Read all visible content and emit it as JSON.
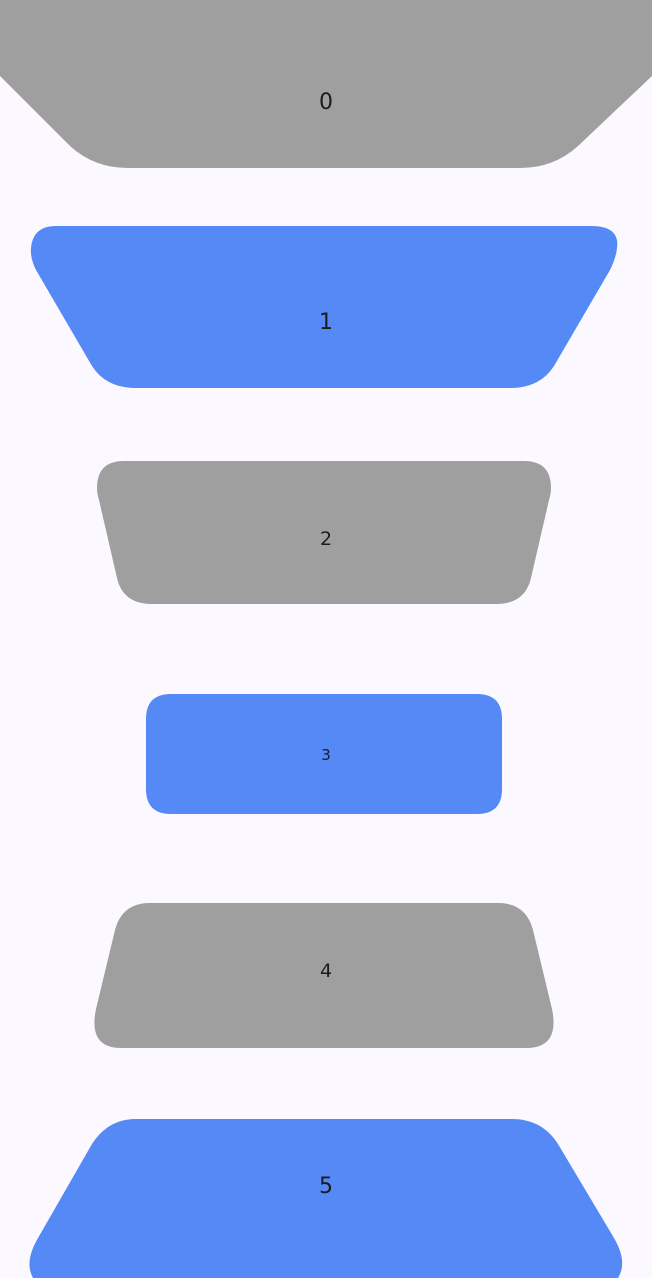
{
  "colors": {
    "background": "#fcf8ff",
    "gray": "#9f9f9f",
    "blue": "#5589f6",
    "text": "#1d1b20"
  },
  "items": [
    {
      "label": "0",
      "color": "gray"
    },
    {
      "label": "1",
      "color": "blue"
    },
    {
      "label": "2",
      "color": "gray"
    },
    {
      "label": "3",
      "color": "blue"
    },
    {
      "label": "4",
      "color": "gray"
    },
    {
      "label": "5",
      "color": "blue"
    }
  ]
}
